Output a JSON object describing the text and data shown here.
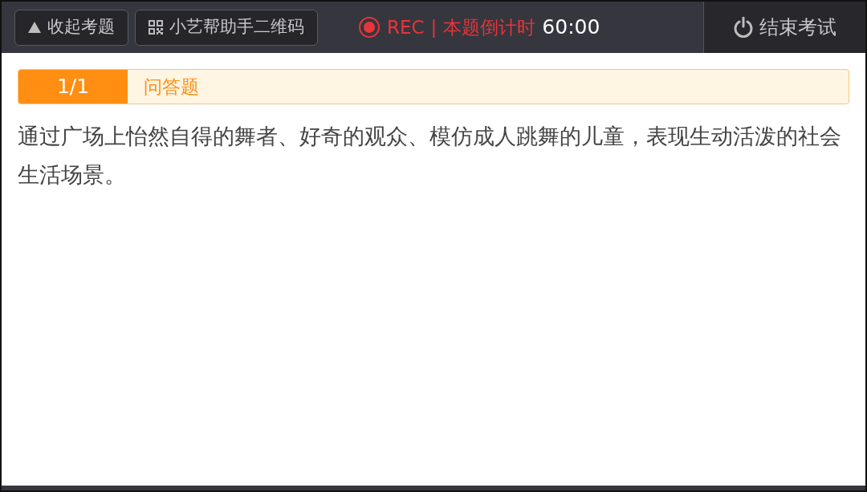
{
  "toolbar": {
    "collapse_button": {
      "label": "收起考题"
    },
    "qr_button": {
      "label": "小艺帮助手二维码"
    },
    "recording": {
      "rec": "REC",
      "separator": "|",
      "label": "本题倒计时",
      "timer": "60:00"
    },
    "end_button": {
      "label": "结束考试"
    }
  },
  "question": {
    "index": "1/1",
    "type": "问答题",
    "text": "通过广场上怡然自得的舞者、好奇的观众、模仿成人跳舞的儿童，表现生动活泼的社会生活场景。"
  }
}
